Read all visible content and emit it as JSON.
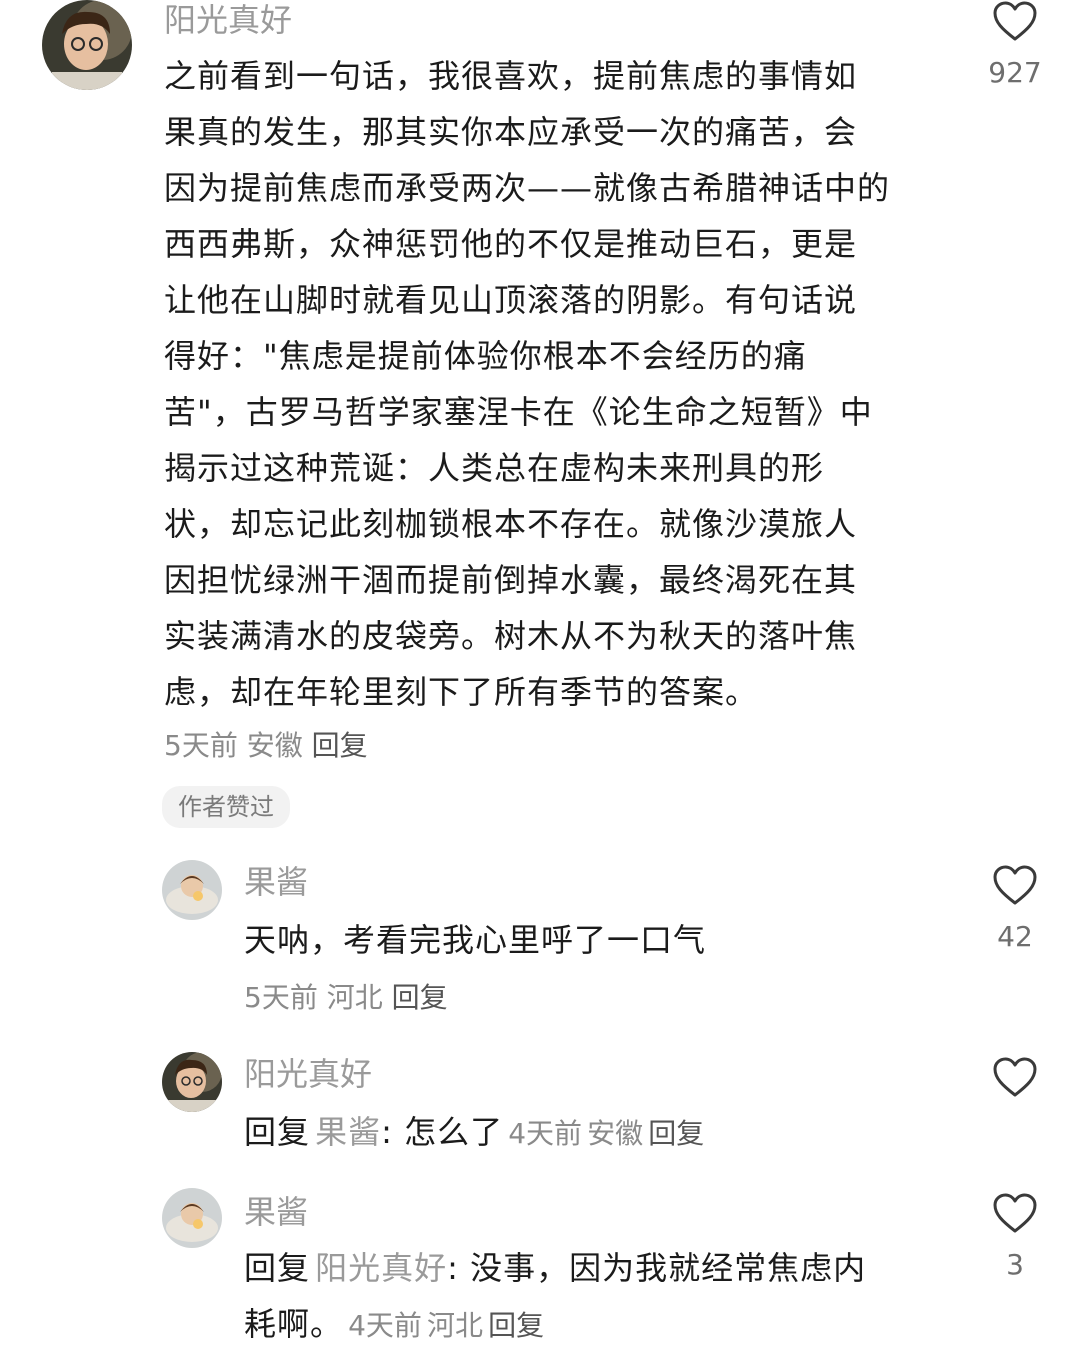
{
  "comments": [
    {
      "username": "阳光真好",
      "lines": [
        "之前看到一句话，我很喜欢，提前焦虑的事情如",
        "果真的发生，那其实你本应承受一次的痛苦，会",
        "因为提前焦虑而承受两次——就像古希腊神话中的",
        "西西弗斯，众神惩罚他的不仅是推动巨石，更是",
        "让他在山脚时就看见山顶滚落的阴影。有句话说",
        "得好：\"焦虑是提前体验你根本不会经历的痛",
        "苦\"，古罗马哲学家塞涅卡在《论生命之短暂》中",
        "揭示过这种荒诞：人类总在虚构未来刑具的形",
        "状，却忘记此刻枷锁根本不存在。就像沙漠旅人",
        "因担忧绿洲干涸而提前倒掉水囊，最终渴死在其",
        "实装满清水的皮袋旁。树木从不为秋天的落叶焦",
        "虑，却在年轮里刻下了所有季节的答案。"
      ],
      "time": "5天前",
      "location": "安徽",
      "reply_label": "回复",
      "likes": "927",
      "badge": "作者赞过"
    }
  ],
  "replies": [
    {
      "username": "果酱",
      "text": "天呐，考看完我心里呼了一口气",
      "time": "5天前",
      "location": "河北",
      "reply_label": "回复",
      "likes": "42"
    },
    {
      "username": "阳光真好",
      "prefix": "回复",
      "target": "果酱",
      "text": ": 怎么了",
      "time": "4天前",
      "location": "安徽",
      "reply_label": "回复",
      "likes": ""
    },
    {
      "username": "果酱",
      "prefix": "回复",
      "target": "阳光真好",
      "text_line1": ": 没事，因为我就经常焦虑内",
      "text_line2": "耗啊。",
      "time": "4天前",
      "location": "河北",
      "reply_label": "回复",
      "likes": "3"
    }
  ],
  "icons": {
    "like": "heart-outline-icon",
    "avatar_boy": "boy-avatar-image",
    "avatar_girl": "girl-avatar-image"
  },
  "colors": {
    "text": "#1b1b1b",
    "username": "#9a9a9a",
    "meta": "#8a8a8a"
  }
}
